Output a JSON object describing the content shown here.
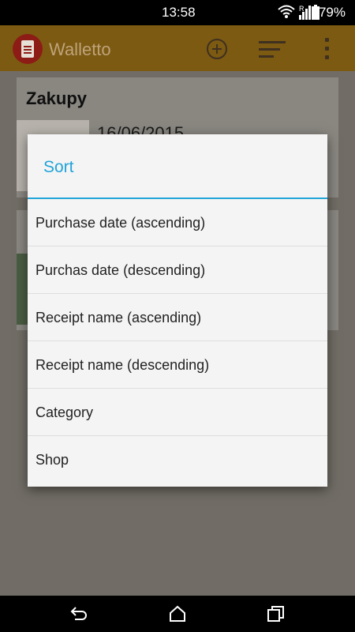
{
  "status_bar": {
    "time": "13:58",
    "battery": "79%",
    "network_label": "R"
  },
  "app_bar": {
    "title": "Walletto"
  },
  "cards": [
    {
      "title": "Zakupy",
      "date": "16/06/2015"
    }
  ],
  "dialog": {
    "title": "Sort",
    "options": [
      "Purchase date (ascending)",
      "Purchas date (descending)",
      "Receipt name (ascending)",
      "Receipt name (descending)",
      "Category",
      "Shop"
    ]
  },
  "colors": {
    "accent": "#21a4d8",
    "app_bar": "#7c5a12",
    "logo": "#8c1c15"
  }
}
